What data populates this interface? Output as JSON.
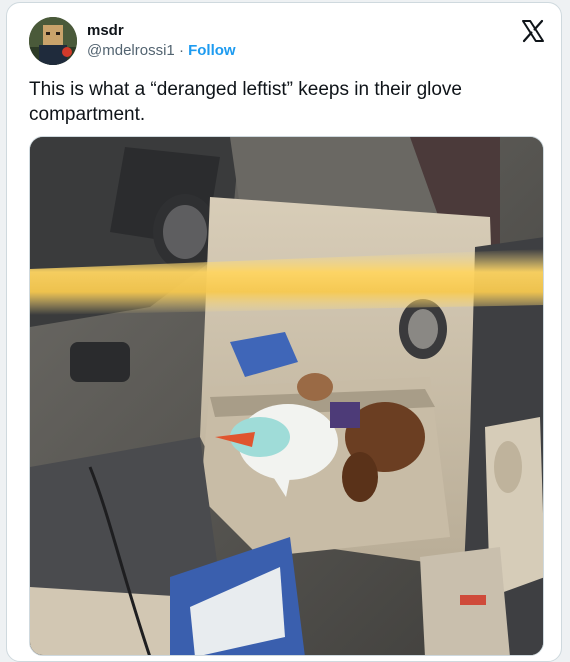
{
  "tweet": {
    "display_name": "msdr",
    "handle": "@mdelrossi1",
    "separator": "·",
    "follow_label": "Follow",
    "text": "This is what a “deranged leftist” keeps in their glove compartment."
  },
  "icons": {
    "platform": "x-logo-icon",
    "media": "car-interior-photo"
  },
  "colors": {
    "link": "#1d9bf0",
    "text": "#0f1419",
    "secondary": "#536471",
    "border": "#cfd9de"
  }
}
